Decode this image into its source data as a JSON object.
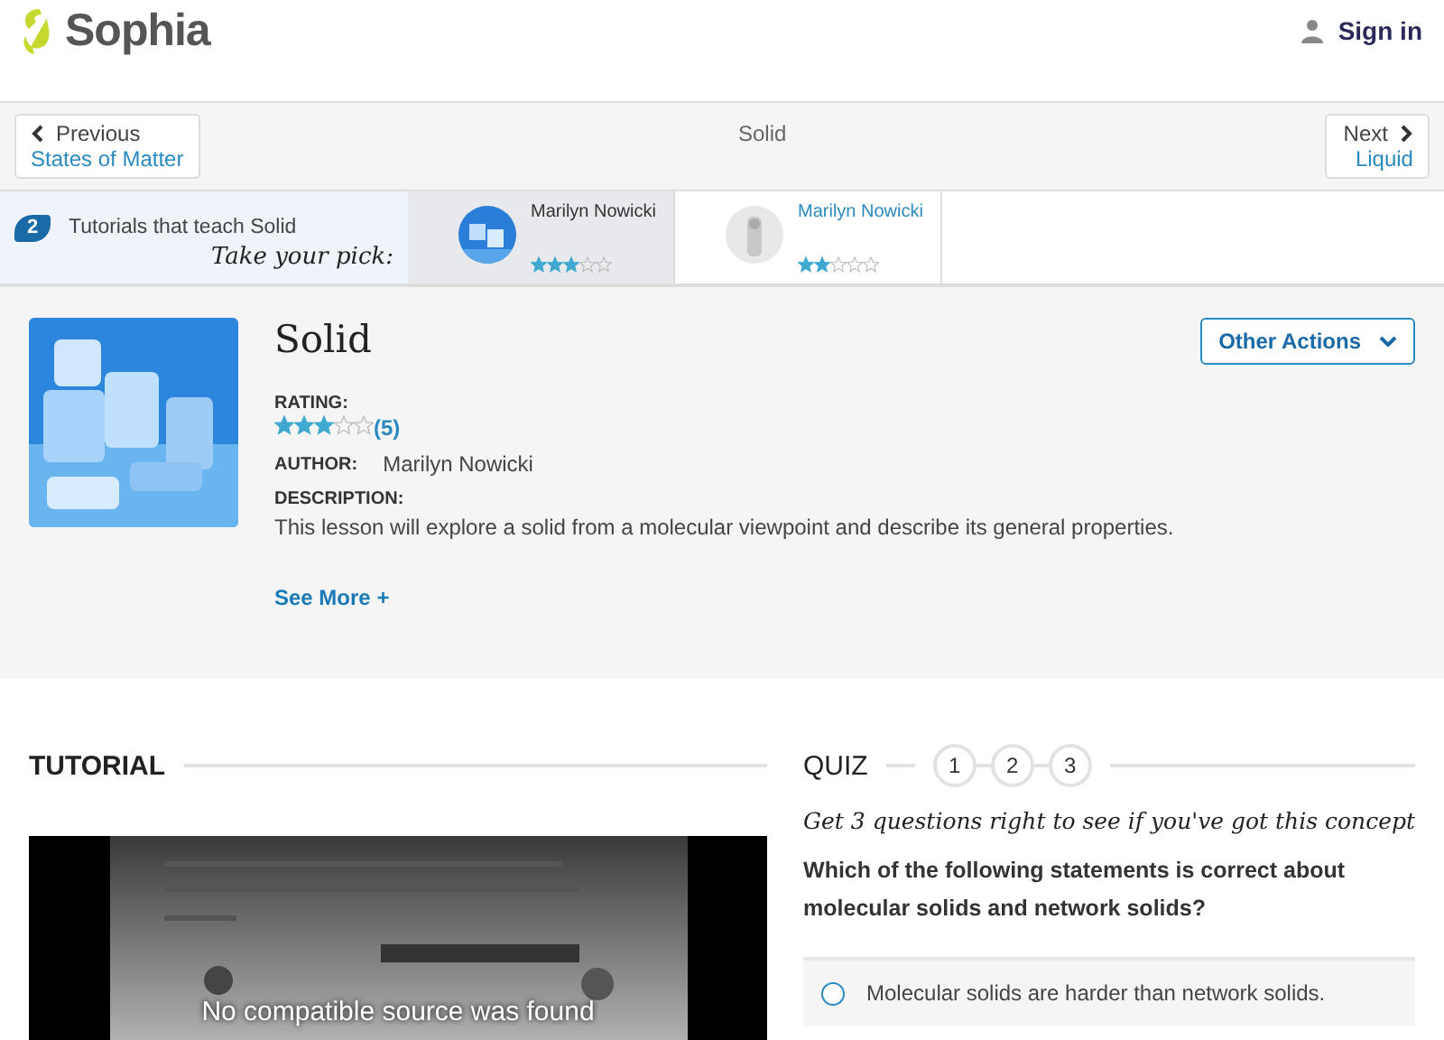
{
  "header": {
    "logo": "Sophia",
    "sign_in": "Sign in"
  },
  "nav": {
    "previous": {
      "label": "Previous",
      "target": "States of Matter"
    },
    "current": "Solid",
    "next": {
      "label": "Next",
      "target": "Liquid"
    }
  },
  "tutorials": {
    "count": "2",
    "label": "Tutorials that teach Solid",
    "hint": "Take your pick:",
    "items": [
      {
        "author": "Marilyn Nowicki",
        "stars": 3,
        "selected": true,
        "kind": "ice"
      },
      {
        "author": "Marilyn Nowicki",
        "stars": 2,
        "selected": false,
        "kind": "figure"
      }
    ]
  },
  "lesson": {
    "title": "Solid",
    "other_actions": "Other Actions",
    "rating_label": "RATING:",
    "stars": 3,
    "rating_count": "(5)",
    "author_label": "AUTHOR:",
    "author": "Marilyn Nowicki",
    "description_label": "DESCRIPTION:",
    "description": "This lesson will explore a solid from a molecular viewpoint and describe its general properties.",
    "see_more": "See More +"
  },
  "tutorial": {
    "heading": "TUTORIAL",
    "player_message": "No compatible source was found"
  },
  "quiz": {
    "heading": "QUIZ",
    "steps": [
      {
        "label": "1",
        "selected": false
      },
      {
        "label": "2",
        "selected": false
      },
      {
        "label": "3",
        "selected": false
      }
    ],
    "tagline": "Get 3 questions right to see if you've got this concept",
    "question": "Which of the following statements is correct about molecular solids and network solids?",
    "options": [
      {
        "text": "Molecular solids are harder than network solids.",
        "selected": false
      }
    ]
  }
}
